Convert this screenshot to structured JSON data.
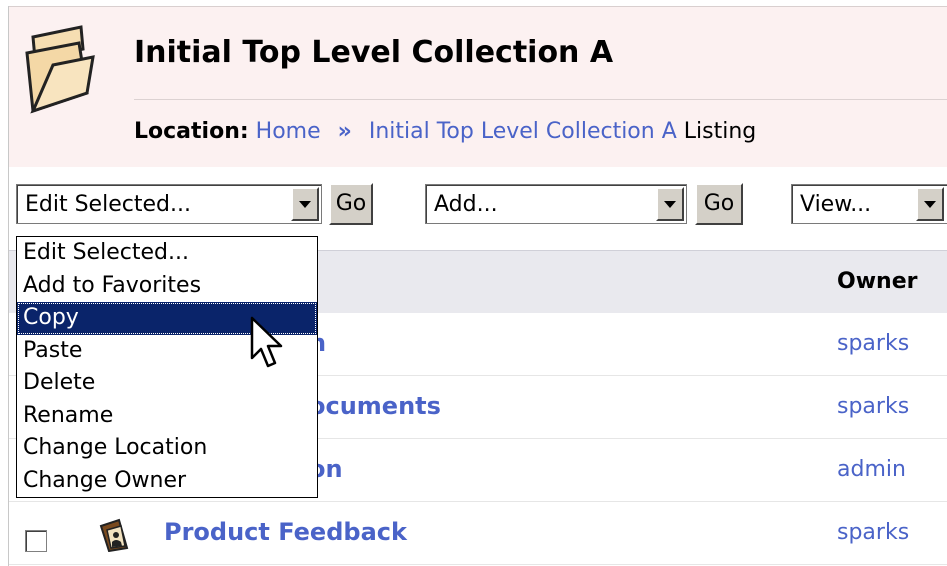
{
  "header": {
    "title": "Initial Top Level Collection A",
    "location_label": "Location:",
    "breadcrumb": {
      "home": "Home",
      "separator": "»",
      "current": "Initial Top Level Collection A",
      "trailing": "Listing"
    }
  },
  "toolbar": {
    "edit_select": {
      "value": "Edit Selected..."
    },
    "edit_go": "Go",
    "add_select": {
      "value": "Add..."
    },
    "add_go": "Go",
    "view_select": {
      "value": "View..."
    }
  },
  "dropdown": {
    "options": [
      "Edit Selected...",
      "Add to Favorites",
      "Copy",
      "Paste",
      "Delete",
      "Rename",
      "Change Location",
      "Change Owner"
    ],
    "selected": "Copy"
  },
  "table": {
    "owner_header": "Owner",
    "rows": [
      {
        "name_fragment": "n",
        "owner": "sparks"
      },
      {
        "name_fragment": "ocuments",
        "owner": "sparks"
      },
      {
        "name_fragment": "on",
        "owner": "admin"
      },
      {
        "name": "Product Feedback",
        "owner": "sparks"
      }
    ]
  },
  "colors": {
    "link": "#4a63c8",
    "header_bg": "#fcf1f1",
    "table_header_bg": "#e9e9ee",
    "selection": "#0a246a"
  },
  "icons": {
    "header": "folder-icon",
    "row": "document-icon",
    "pointer": "mouse-cursor-icon"
  }
}
